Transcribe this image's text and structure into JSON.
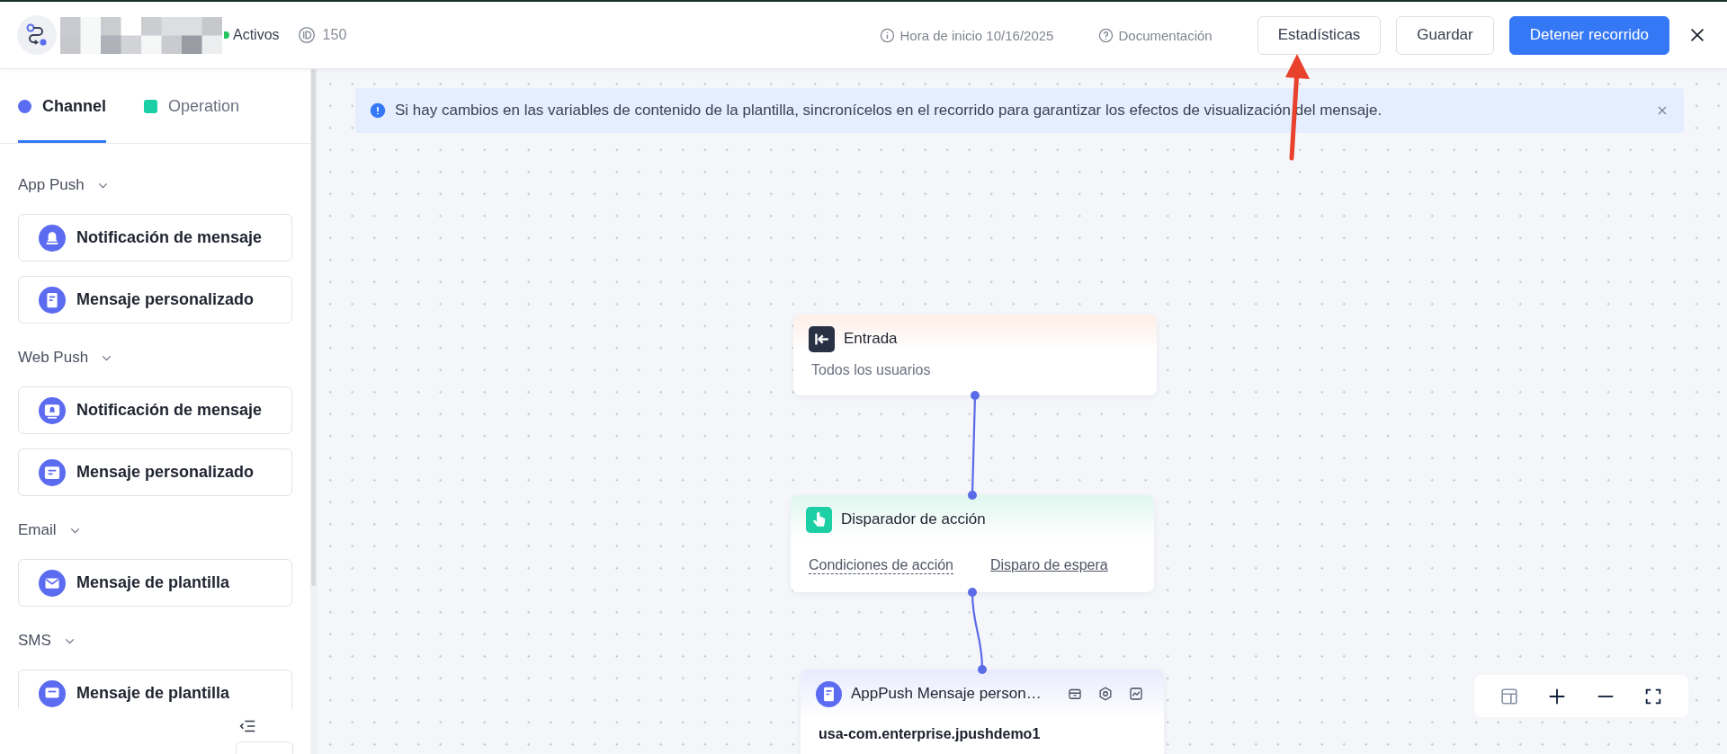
{
  "header": {
    "status": {
      "label": "Activos",
      "active": true
    },
    "id": "150",
    "start_time": "Hora de inicio 10/16/2025",
    "docs": "Documentación",
    "buttons": [
      {
        "label": "Estadísticas",
        "kind": "default"
      },
      {
        "label": "Guardar",
        "kind": "default"
      },
      {
        "label": "Detener recorrido",
        "kind": "primary"
      }
    ]
  },
  "sidebar": {
    "tabs": [
      {
        "label": "Channel",
        "selected": true,
        "color": "#5c6cf0"
      },
      {
        "label": "Operation",
        "selected": false,
        "color": "#1ccfa4"
      }
    ],
    "groups": [
      {
        "title": "App Push",
        "expanded": true,
        "items": [
          {
            "label": "Notificación de mensaje",
            "kind": "bell"
          },
          {
            "label": "Mensaje personalizado",
            "kind": "doc"
          }
        ]
      },
      {
        "title": "Web Push",
        "expanded": true,
        "items": [
          {
            "label": "Notificación de mensaje",
            "kind": "screen-bell"
          },
          {
            "label": "Mensaje personalizado",
            "kind": "screen-doc"
          }
        ]
      },
      {
        "title": "Email",
        "expanded": true,
        "items": [
          {
            "label": "Mensaje de plantilla",
            "kind": "mail"
          }
        ]
      },
      {
        "title": "SMS",
        "expanded": true,
        "items": [
          {
            "label": "Mensaje de plantilla",
            "kind": "sms"
          }
        ]
      }
    ]
  },
  "banner": {
    "text": "Si hay cambios en las variables de contenido de la plantilla, sincronícelos en el recorrido para garantizar los efectos de visualización del mensaje."
  },
  "nodes": [
    {
      "kind": "entry",
      "title": "Entrada",
      "subtitle": "Todos los usuarios"
    },
    {
      "kind": "trigger",
      "title": "Disparador de acción",
      "links": [
        "Condiciones de acción",
        "Disparo de espera"
      ]
    },
    {
      "kind": "message",
      "title": "AppPush Mensaje person…",
      "body": "usa-com.enterprise.jpushdemo1"
    }
  ],
  "annotations": [
    {
      "kind": "arrow",
      "color": "#e8412c"
    }
  ]
}
